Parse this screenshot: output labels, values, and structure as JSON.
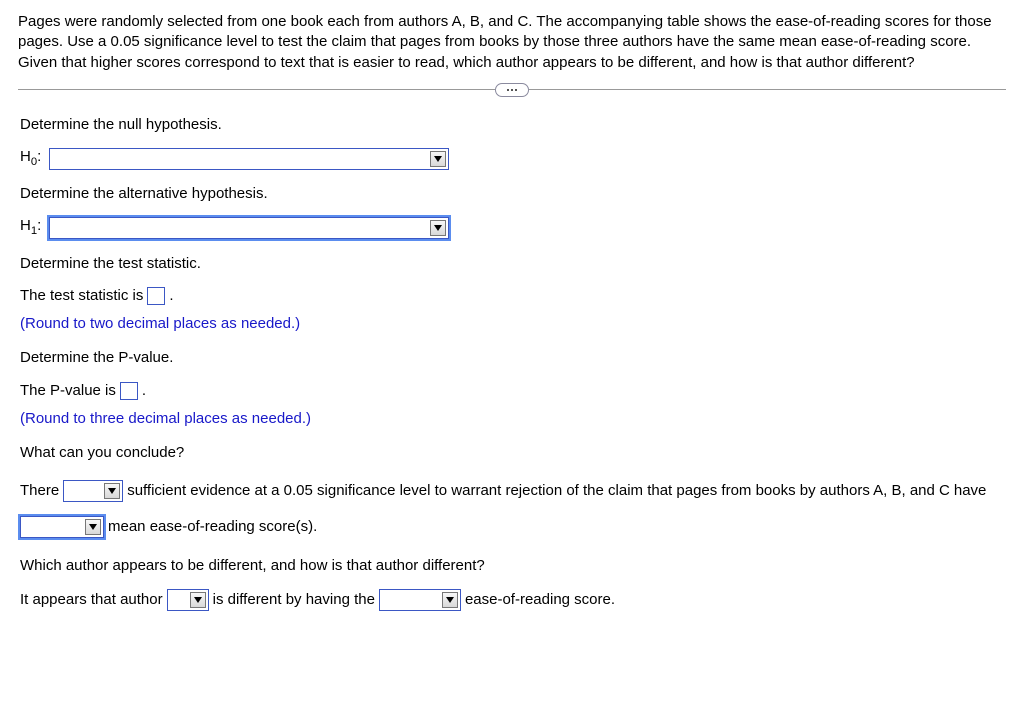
{
  "intro": "Pages were randomly selected from one book each from authors A, B, and C. The accompanying table shows the ease-of-reading scores for those pages. Use a 0.05 significance level to test the claim that pages from books by those three authors have the same mean ease-of-reading score. Given that higher scores correspond to text that is easier to read, which author appears to be different, and how is that author different?",
  "p_null": "Determine the null hypothesis.",
  "h0_label_pre": "H",
  "h0_sub": "0",
  "h0_label_post": ":",
  "p_alt": "Determine the alternative hypothesis.",
  "h1_label_pre": "H",
  "h1_sub": "1",
  "h1_label_post": ":",
  "p_ts": "Determine the test statistic.",
  "ts_pre": "The test statistic is ",
  "ts_post": ".",
  "ts_hint": "(Round to two decimal places as needed.)",
  "p_pv": "Determine the P-value.",
  "pv_pre": "The P-value is ",
  "pv_post": ".",
  "pv_hint": "(Round to three decimal places as needed.)",
  "p_conc": "What can you conclude?",
  "conc_1": "There",
  "conc_2": "sufficient evidence at a 0.05 significance level to warrant rejection of the claim that pages from books by authors A, B, and C",
  "conc_3": "have",
  "conc_4": "mean ease-of-reading score(s).",
  "p_which": "Which author appears to be different, and how is that author different?",
  "which_1": "It appears that author",
  "which_2": "is different by having the",
  "which_3": "ease-of-reading score."
}
